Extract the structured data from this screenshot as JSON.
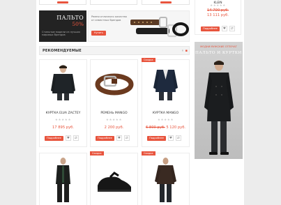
{
  "colors": {
    "accent": "#e8543d",
    "page_bg": "#ececec"
  },
  "promo_coat": {
    "title": "ПАЛЬТО",
    "discount": "50%",
    "text": "Стильные модели из лучших мировых брендов"
  },
  "promo_belts": {
    "text": "Ремни отличного качества от известных брендов",
    "button": "Купить"
  },
  "side_product": {
    "name": "KLEIN",
    "old_price": "14 700 руб.",
    "new_price": "13 111 руб.",
    "details_button": "Подробнее"
  },
  "recommended": {
    "title": "РЕКОМЕНДУЕМЫЕ",
    "prev_icon": "prev-arrow-icon",
    "next_icon": "next-arrow-icon",
    "badge_label": "Скидка",
    "details_button": "Подробнее",
    "products": [
      {
        "name": "КУРТКА ELVA ZACTEY",
        "price": "17 895 руб.",
        "old_price": "",
        "badge": false,
        "image": "coat-icon"
      },
      {
        "name": "РЕМЕНЬ MANGO",
        "price": "2 200 руб.",
        "old_price": "",
        "badge": false,
        "image": "belt-icon"
      },
      {
        "name": "КУРТКА MANGO",
        "price": "5 120 руб.",
        "old_price": "6 800 руб.",
        "badge": true,
        "image": "jacket-icon"
      }
    ],
    "row2": [
      {
        "badge": false,
        "image": "dark-outfit-icon"
      },
      {
        "badge": true,
        "image": "shoe-icon"
      },
      {
        "badge": true,
        "image": "leather-jacket-icon"
      }
    ]
  },
  "side_ad": {
    "line1": "МОДНИ МУЖСКИЕ ОТПЕЧАТ",
    "line2": "ПАЛЬТО И КУРТКИ"
  }
}
